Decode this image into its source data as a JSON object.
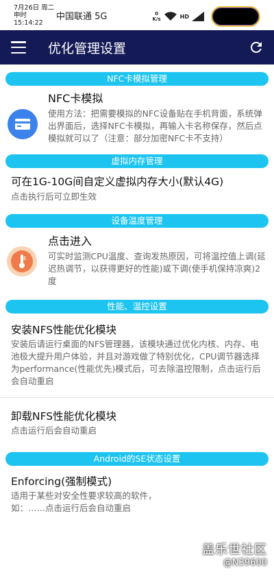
{
  "status_bar": {
    "date": "7月26日 周二",
    "time": "申时 15:14:22",
    "carrier": "中国联通 5G",
    "net_speed_value": "0",
    "net_speed_unit": "K/s",
    "hd": "HD"
  },
  "app_bar": {
    "title": "优化管理设置",
    "menu_icon": "menu-icon",
    "refresh_icon": "refresh-icon",
    "background": "#131a56"
  },
  "accent_color": "#1dc4f0",
  "sections": {
    "nfc": {
      "header": "NFC卡模拟管理",
      "title": "NFC卡模拟",
      "desc": "使用方法：把需要模拟的NFC设备贴在手机背面，系统弹出界面后，选择NFC卡模拟，再输入卡名称保存，然后点模拟就可以了（注意：部分加密NFC卡不支持）",
      "icon": "card-icon"
    },
    "vmem": {
      "header": "虚拟内存管理",
      "title": "可在1G-10G间自定义虚拟内存大小(默认4G)",
      "desc": "点击执行后可立即生效"
    },
    "temp": {
      "header": "设备温度管理",
      "title": "点击进入",
      "desc": "可实时监测CPU温度、查询发热原因，可将温控值上调(延迟热调节，以获得更好的性能)或下调(使手机保持凉爽)2度",
      "icon": "thermometer-icon"
    },
    "perf": {
      "header": "性能、温控设置",
      "install_title": "安装NFS性能优化模块",
      "install_desc": "安装后请运行桌面的NFS管理器，该模块通过优化内核、内存、电池极大提升用户体验，并且对游戏做了特别优化，CPU调节器选择为performance(性能优先)模式后，可去除温控限制，点击运行后会自动重启",
      "uninstall_title": "卸载NFS性能优化模块",
      "uninstall_desc": "点击运行后会自动重启"
    },
    "se": {
      "header": "Android的SE状态设置",
      "title": "Enforcing(强制模式)",
      "desc": "适用于某些对安全性要求较高的软件，如：……点击运行后会自动重启"
    }
  },
  "watermark": {
    "title": "盖乐世社区",
    "user": "@N39600"
  }
}
